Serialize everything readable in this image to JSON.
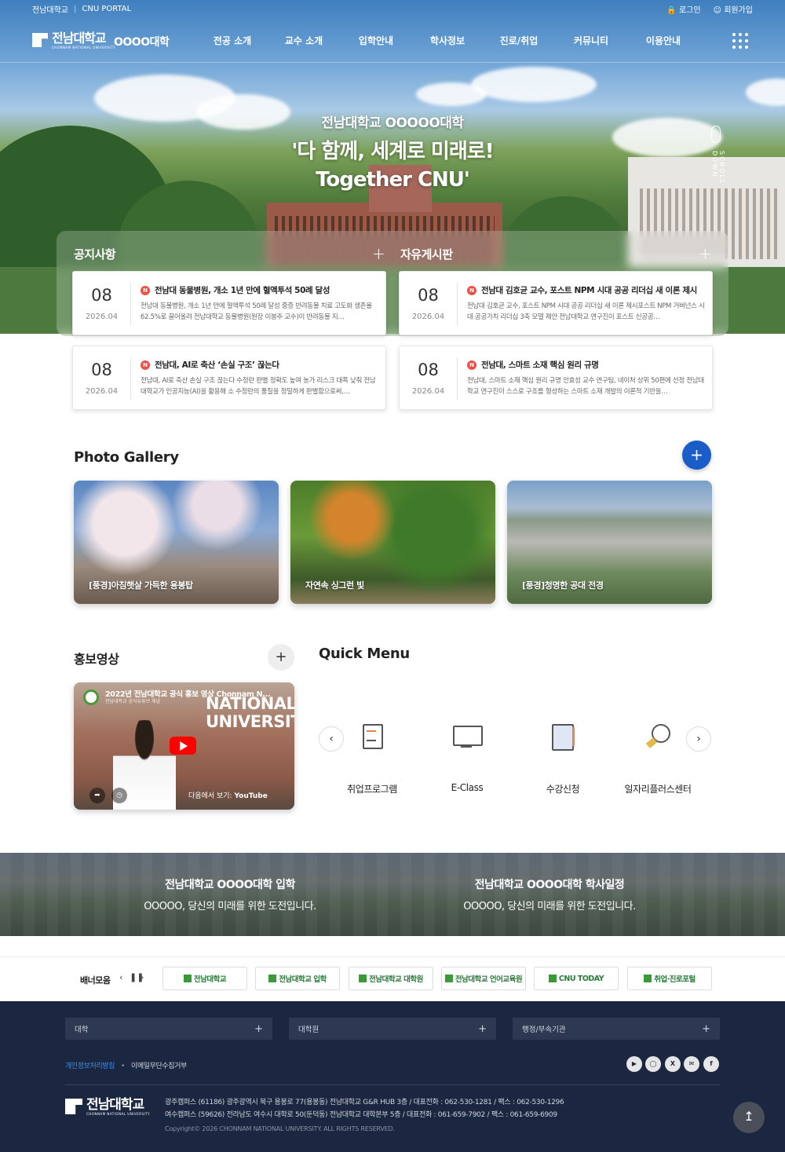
{
  "topbar": {
    "left1": "전남대학교",
    "sep": "|",
    "left2": "CNU PORTAL",
    "login": "로그인",
    "join": "회원가입"
  },
  "header": {
    "logo_text": "전남대학교",
    "logo_sub": "CHONNAM NATIONAL UNIVERSITY",
    "college": "OOOO대학",
    "nav": [
      "전공 소개",
      "교수 소개",
      "입학안내",
      "학사정보",
      "진로/취업",
      "커뮤니티",
      "이용안내"
    ]
  },
  "hero": {
    "subtitle": "전남대학교 OOOOO대학",
    "title_line1": "'다 함께, 세계로 미래로!",
    "title_line2": "Together CNU'",
    "scroll": "SCROLL DOWN"
  },
  "notice": {
    "title": "공지사항",
    "plus": "+"
  },
  "board": {
    "title": "자유게시판",
    "plus": "+"
  },
  "posts": [
    {
      "day": "08",
      "date": "2026.04",
      "badge": "N",
      "title": "전남대 동물병원, 개소 1년 만에 혈액투석 50례 달성",
      "desc": "전남대 동물병원, 개소 1년 만에 혈액투석 50례 달성 중증 반려동물 치료 고도화 생존율 62.5%로 끌어올려 전남대학교 동물병원(원장 이봉주 교수)이 반려동물 지…"
    },
    {
      "day": "08",
      "date": "2026.04",
      "badge": "N",
      "title": "전남대 김호균 교수, 포스트 NPM 시대 공공 리더십 새 이론 제시",
      "desc": "전남대 김호균 교수, 포스트 NPM 시대 공공 리더십 새 이론 제시포스트 NPM 거버넌스 시대 공공가치 리더십 3축 모델 제안 전남대학교 연구진이 포스트 신공공…"
    },
    {
      "day": "08",
      "date": "2026.04",
      "badge": "N",
      "title": "전남대, AI로 축산 ‘손실 구조’ 끊는다",
      "desc": "전남대, AI로 축산 손실 구조 끊는다 수정란 판별 정확도 높여 농가 리스크 대폭 낮춰 전남대학교가 인공지능(AI)을 활용해 소 수정란의 품질을 정밀하게 판별함으로써,…"
    },
    {
      "day": "08",
      "date": "2026.04",
      "badge": "N",
      "title": "전남대, 스마트 소재 핵심 원리 규명",
      "desc": "전남대, 스마트 소재 핵심 원리 규명 안효성 교수 연구팀, 네이처 상위 50편에 선정 전남대학교 연구진이 스스로 구조를 형성하는 스마트 소재 개발의 이론적 기반을…"
    }
  ],
  "gallery": {
    "title": "Photo Gallery",
    "plus": "+",
    "items": [
      "[풍경]아침햇살 가득한 용봉탑",
      "자연속 싱그런 빛",
      "[풍경]청명한 공대 전경"
    ]
  },
  "promo": {
    "title": "홍보영상",
    "plus": "+",
    "video_title": "2022년 전남대학교 공식 홍보 영상 Chonnam N...",
    "video_channel": "전남대학교 공식유튜브 채널",
    "video_big1": "NATIONAL",
    "video_big2": "UNIVERSITY",
    "watch_on": "다음에서 보기:",
    "youtube": "YouTube"
  },
  "quick": {
    "title": "Quick Menu",
    "prev": "‹",
    "next": "›",
    "items": [
      "취업프로그램",
      "E-Class",
      "수강신청",
      "일자리플러스센터"
    ]
  },
  "strip": [
    {
      "title": "전남대학교 OOOO대학 입학",
      "desc": "OOOOO, 당신의 미래를 위한 도전입니다."
    },
    {
      "title": "전남대학교 OOOO대학 학사일정",
      "desc": "OOOOO, 당신의 미래를 위한 도전입니다."
    }
  ],
  "banners": {
    "label": "배너모음",
    "items": [
      "전남대학교",
      "전남대학교 입학",
      "전남대학교 대학원",
      "전남대학교 언어교육원",
      "CNU TODAY",
      "취업·진로포털"
    ]
  },
  "footer": {
    "selects": [
      "대학",
      "대학원",
      "행정/부속기관"
    ],
    "privacy": "개인정보처리방침",
    "email": "이메일무단수집거부",
    "social": [
      "youtube-icon",
      "instagram-icon",
      "x-icon",
      "chat-icon",
      "facebook-icon"
    ],
    "addr1": "광주캠퍼스 (61186) 광주광역시 북구 용봉로 77(용봉동) 전남대학교 G&R HUB 3층 / 대표전화 : 062-530-1281 / 팩스 : 062-530-1296",
    "addr2": "여수캠퍼스 (59626) 전라남도 여수시 대학로 50(둔덕동) 전남대학교 대학본부 5층 / 대표전화 : 061-659-7902 / 팩스 : 061-659-6909",
    "copyright": "Copyright© 2026 CHONNAM NATIONAL UNIVERSITY. ALL RIGHTS RESERVED."
  }
}
